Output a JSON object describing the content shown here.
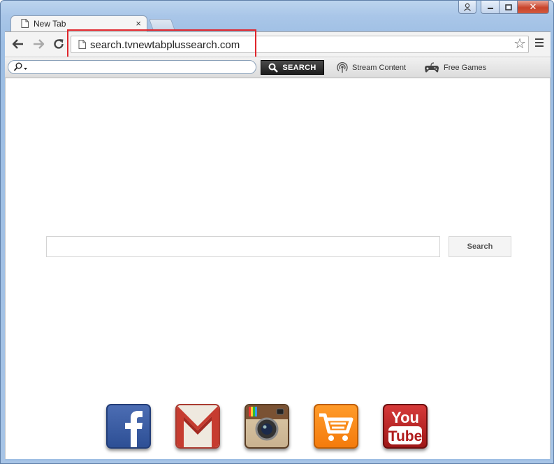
{
  "window": {
    "caption_buttons": [
      "user-icon",
      "minimize-icon",
      "maximize-icon",
      "close-icon"
    ],
    "close_glyph": "✕"
  },
  "tabs": [
    {
      "title": "New Tab",
      "close_glyph": "×"
    }
  ],
  "toolbar": {
    "url": "search.tvnewtabplussearch.com",
    "highlight_color": "#e0252b"
  },
  "extension_bar": {
    "search_button_label": "SEARCH",
    "links": [
      {
        "label": "Stream Content",
        "icon": "broadcast-icon"
      },
      {
        "label": "Free Games",
        "icon": "gamepad-icon"
      }
    ]
  },
  "page": {
    "search_input_value": "",
    "search_button_label": "Search",
    "tiles": [
      {
        "name": "facebook",
        "icon": "facebook-icon",
        "color": "#3b5998"
      },
      {
        "name": "gmail",
        "icon": "gmail-icon",
        "color": "#d44638"
      },
      {
        "name": "instagram",
        "icon": "instagram-icon",
        "color": "#c9b290"
      },
      {
        "name": "shopping",
        "icon": "shopping-cart-icon",
        "color": "#f47b0c"
      },
      {
        "name": "youtube",
        "icon": "youtube-icon",
        "color": "#c4302b",
        "text_top": "You",
        "text_bottom": "Tube"
      }
    ]
  }
}
